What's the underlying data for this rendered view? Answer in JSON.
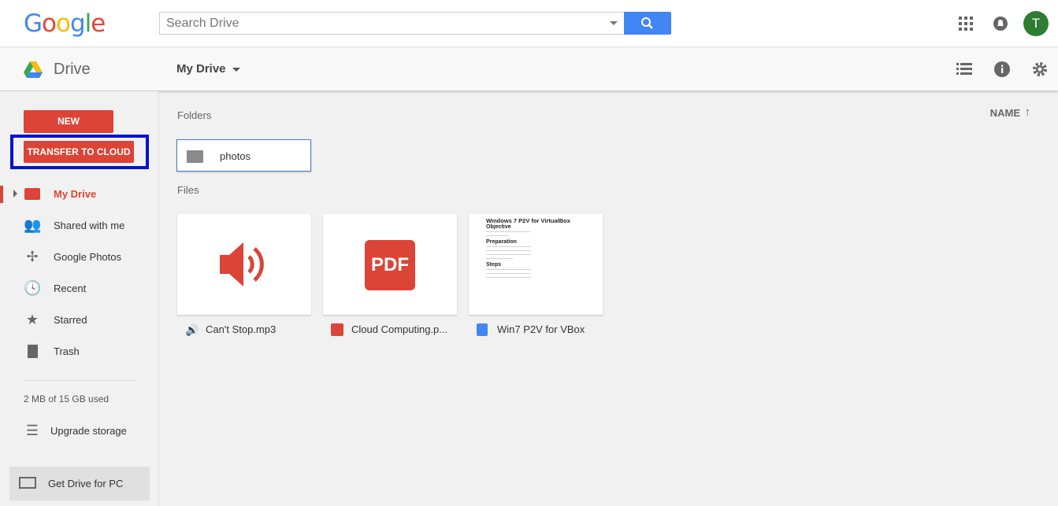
{
  "header": {
    "logo": "Google",
    "search_placeholder": "Search Drive",
    "avatar_letter": "T"
  },
  "subheader": {
    "app_name": "Drive",
    "location": "My Drive"
  },
  "sidebar": {
    "new_label": "NEW",
    "transfer_label": "TRANSFER TO CLOUD",
    "items": [
      {
        "label": "My Drive",
        "icon": "my-drive-icon",
        "active": true
      },
      {
        "label": "Shared with me",
        "icon": "people-icon"
      },
      {
        "label": "Google Photos",
        "icon": "pinwheel-icon"
      },
      {
        "label": "Recent",
        "icon": "clock-icon"
      },
      {
        "label": "Starred",
        "icon": "star-icon"
      },
      {
        "label": "Trash",
        "icon": "trash-icon"
      }
    ],
    "storage": "2 MB of 15 GB used",
    "upgrade": "Upgrade storage",
    "get_drive": "Get Drive for PC"
  },
  "main": {
    "sort_label": "NAME",
    "folders_heading": "Folders",
    "files_heading": "Files",
    "folders": [
      {
        "name": "photos"
      }
    ],
    "files": [
      {
        "name": "Can't Stop.mp3",
        "type": "audio"
      },
      {
        "name": "Cloud Computing.p...",
        "type": "pdf",
        "thumb_text": "PDF"
      },
      {
        "name": "Win7 P2V for VBox",
        "type": "doc",
        "thumb": {
          "title": "Windows 7 P2V for VirtualBox",
          "sections": [
            "Objective",
            "Preparation",
            "Steps"
          ]
        }
      }
    ]
  },
  "colors": {
    "accent": "#db4437",
    "blue": "#4285f4",
    "highlight": "#0012d6"
  }
}
